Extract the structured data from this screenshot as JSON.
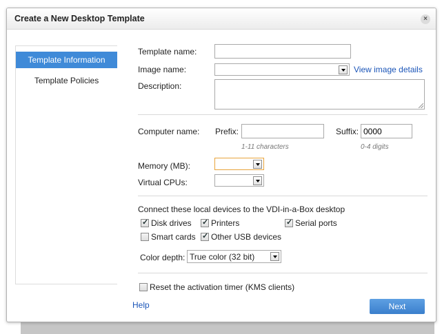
{
  "dialog": {
    "title": "Create a New Desktop Template",
    "close_symbol": "×"
  },
  "sidebar": {
    "items": [
      {
        "label": "Template Information",
        "active": true
      },
      {
        "label": "Template Policies",
        "active": false
      }
    ]
  },
  "form": {
    "template_name_label": "Template name:",
    "template_name_value": "",
    "image_name_label": "Image name:",
    "image_name_value": "",
    "view_image_details_link": "View image details",
    "description_label": "Description:",
    "description_value": "",
    "computer_name_label": "Computer name:",
    "prefix_label": "Prefix:",
    "prefix_value": "",
    "prefix_hint": "1-11 characters",
    "suffix_label": "Suffix:",
    "suffix_value": "0000",
    "suffix_hint": "0-4 digits",
    "memory_label": "Memory (MB):",
    "memory_value": "",
    "vcpu_label": "Virtual CPUs:",
    "vcpu_value": ""
  },
  "devices": {
    "heading": "Connect these local devices to the VDI-in-a-Box desktop",
    "options": [
      {
        "label": "Disk drives",
        "checked": true
      },
      {
        "label": "Printers",
        "checked": true
      },
      {
        "label": "Serial ports",
        "checked": true
      },
      {
        "label": "Smart cards",
        "checked": false
      },
      {
        "label": "Other USB devices",
        "checked": true
      }
    ],
    "color_depth_label": "Color depth:",
    "color_depth_value": "True color (32 bit)"
  },
  "reset": {
    "label": "Reset the activation timer (KMS clients)",
    "checked": false
  },
  "footer": {
    "help_link": "Help",
    "next_label": "Next"
  },
  "colors": {
    "accent": "#3f8ad8",
    "link": "#1b55b8",
    "memory_focus_border": "#e8a33a"
  }
}
